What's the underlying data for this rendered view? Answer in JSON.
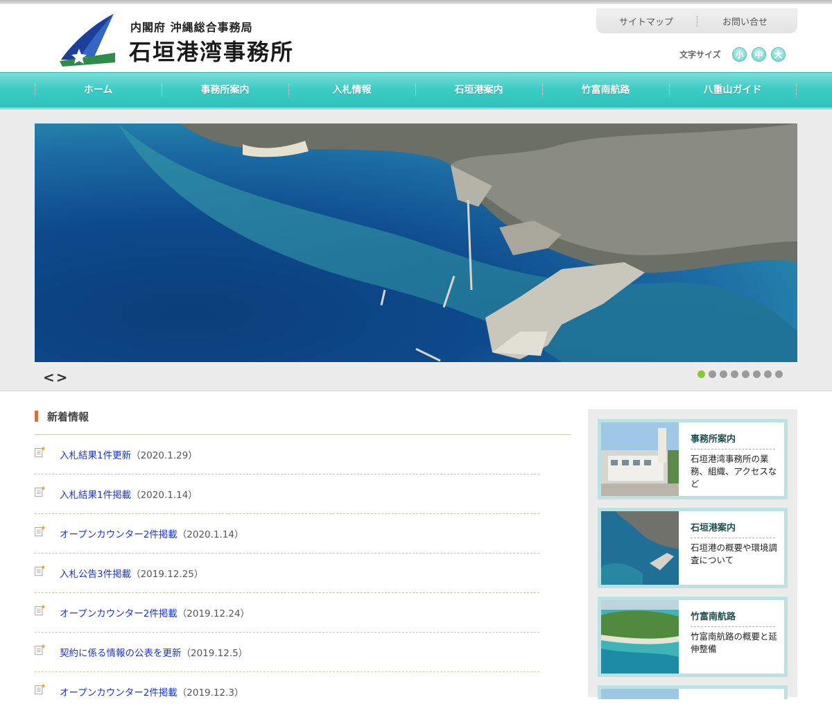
{
  "header": {
    "org_line": "内閣府 沖縄総合事務局",
    "org_name": "石垣港湾事務所",
    "utility": {
      "sitemap": "サイトマップ",
      "contact": "お問い合せ"
    },
    "font_size": {
      "label": "文字サイズ",
      "small": "小",
      "medium": "中",
      "large": "大"
    }
  },
  "nav": {
    "items": [
      {
        "label": "ホーム"
      },
      {
        "label": "事務所案内"
      },
      {
        "label": "入札情報"
      },
      {
        "label": "石垣港案内"
      },
      {
        "label": "竹富南航路"
      },
      {
        "label": "八重山ガイド"
      }
    ]
  },
  "slider": {
    "prev": "<",
    "next": ">",
    "slide_count": 8,
    "active_index": 0
  },
  "news": {
    "title": "新着情報",
    "items": [
      {
        "text": "入札結果1件更新",
        "date": "（2020.1.29）"
      },
      {
        "text": "入札結果1件掲載",
        "date": "（2020.1.14）"
      },
      {
        "text": "オープンカウンター2件掲載",
        "date": "（2020.1.14）"
      },
      {
        "text": "入札公告3件掲載",
        "date": "（2019.12.25）"
      },
      {
        "text": "オープンカウンター2件掲載",
        "date": "（2019.12.24）"
      },
      {
        "text": "契約に係る情報の公表を更新",
        "date": "（2019.12.5）"
      },
      {
        "text": "オープンカウンター2件掲載",
        "date": "（2019.12.3）"
      }
    ]
  },
  "side": {
    "cards": [
      {
        "title": "事務所案内",
        "desc": "石垣港湾事務所の業務、組織、アクセスなど"
      },
      {
        "title": "石垣港案内",
        "desc": "石垣港の概要や環境調査について"
      },
      {
        "title": "竹富南航路",
        "desc": "竹富南航路の概要と延伸整備"
      }
    ]
  },
  "colors": {
    "nav": "#3ccdc5",
    "link": "#1a35c8",
    "accent": "#e06a3a",
    "dot_active": "#8cc63f"
  }
}
